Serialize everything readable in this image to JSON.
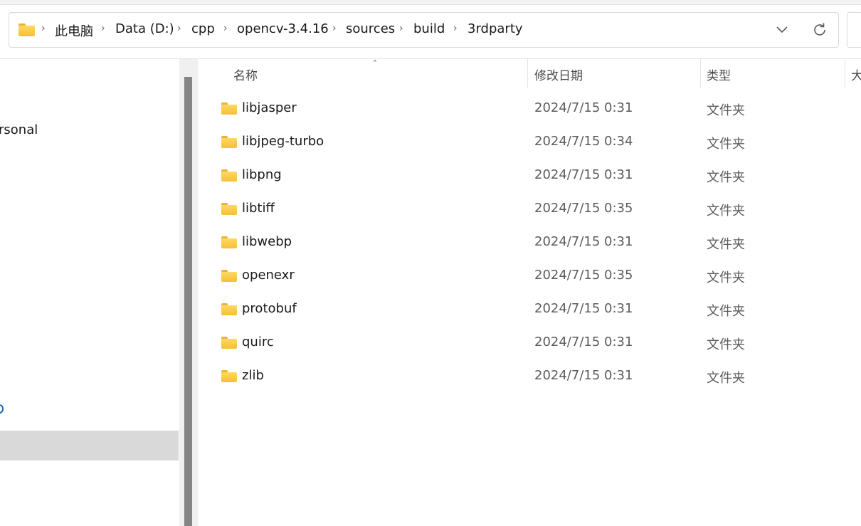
{
  "address_bar": {
    "breadcrumbs": [
      "此电脑",
      "Data (D:)",
      "cpp",
      "opencv-3.4.16",
      "sources",
      "build",
      "3rdparty"
    ],
    "icons": {
      "location": "folder-icon",
      "history": "chevron-down-icon",
      "refresh": "refresh-icon"
    }
  },
  "nav_pane": {
    "partial_item_label": "rsonal"
  },
  "file_list": {
    "columns": {
      "name": "名称",
      "date": "修改日期",
      "type": "类型",
      "size": "大"
    },
    "sort": {
      "column": "name",
      "direction": "ascending"
    },
    "rows": [
      {
        "name": "libjasper",
        "date": "2024/7/15 0:31",
        "type": "文件夹"
      },
      {
        "name": "libjpeg-turbo",
        "date": "2024/7/15 0:34",
        "type": "文件夹"
      },
      {
        "name": "libpng",
        "date": "2024/7/15 0:31",
        "type": "文件夹"
      },
      {
        "name": "libtiff",
        "date": "2024/7/15 0:35",
        "type": "文件夹"
      },
      {
        "name": "libwebp",
        "date": "2024/7/15 0:31",
        "type": "文件夹"
      },
      {
        "name": "openexr",
        "date": "2024/7/15 0:35",
        "type": "文件夹"
      },
      {
        "name": "protobuf",
        "date": "2024/7/15 0:31",
        "type": "文件夹"
      },
      {
        "name": "quirc",
        "date": "2024/7/15 0:31",
        "type": "文件夹"
      },
      {
        "name": "zlib",
        "date": "2024/7/15 0:31",
        "type": "文件夹"
      }
    ]
  },
  "colors": {
    "folder": "#f5c035",
    "selection": "#d9d9d9",
    "scrollbar_thumb": "#858585",
    "accent": "#1766c0"
  }
}
